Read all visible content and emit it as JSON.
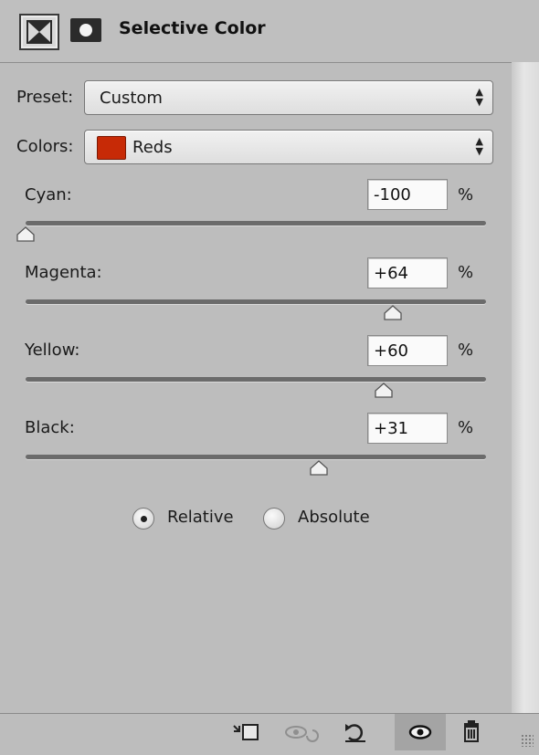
{
  "panel": {
    "title": "Selective Color",
    "header_icons": [
      "adjustment-layer-icon",
      "layer-mask-icon"
    ]
  },
  "preset": {
    "label": "Preset:",
    "value": "Custom"
  },
  "colors": {
    "label": "Colors:",
    "value": "Reds",
    "swatch_color": "#c72a06"
  },
  "sliders": [
    {
      "label": "Cyan:",
      "value": "-100",
      "unit": "%",
      "level": -100,
      "range": [
        -100,
        100
      ]
    },
    {
      "label": "Magenta:",
      "value": "+64",
      "unit": "%",
      "level": 64,
      "range": [
        -100,
        100
      ]
    },
    {
      "label": "Yellow:",
      "value": "+60",
      "unit": "%",
      "level": 60,
      "range": [
        -100,
        100
      ]
    },
    {
      "label": "Black:",
      "value": "+31",
      "unit": "%",
      "level": 31,
      "range": [
        -100,
        100
      ]
    }
  ],
  "method": {
    "options": [
      {
        "label": "Relative",
        "selected": true
      },
      {
        "label": "Absolute",
        "selected": false
      }
    ]
  },
  "footer": {
    "icons": [
      "clip-to-layer-icon",
      "view-previous-state-icon",
      "reset-icon",
      "toggle-visibility-icon",
      "delete-icon"
    ]
  }
}
